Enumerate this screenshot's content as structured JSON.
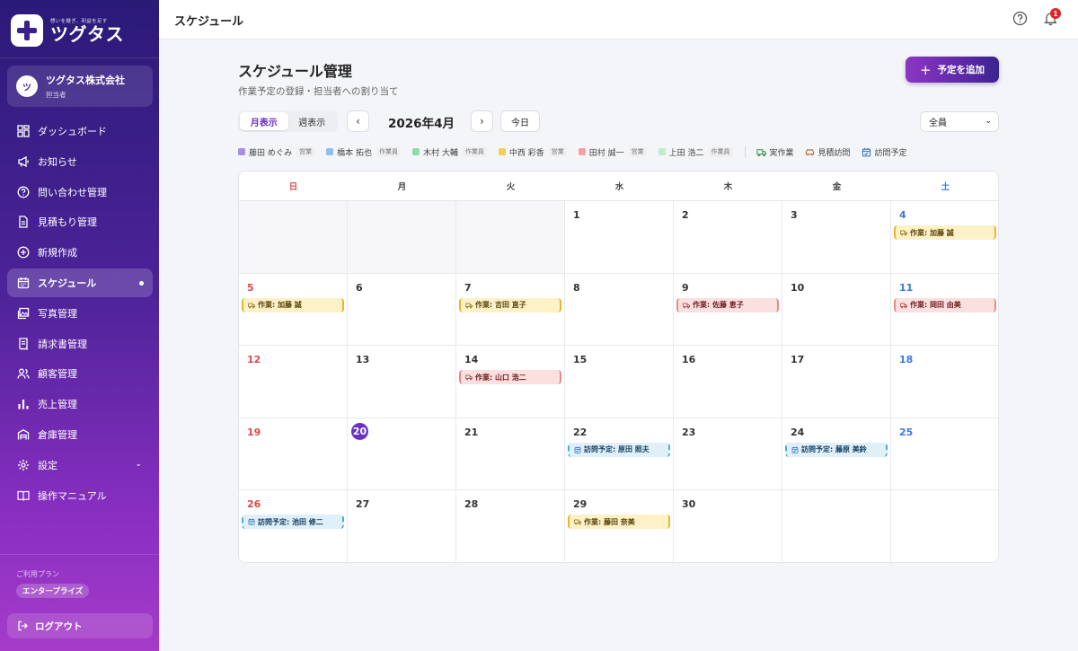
{
  "sidebar": {
    "logo_tagline": "想いを継ぎ、利益を足す",
    "logo_name": "ツグタス",
    "company_initial": "ツ",
    "company_name": "ツグタス株式会社",
    "company_role": "担当者",
    "items": [
      {
        "label": "ダッシュボード",
        "icon": "dashboard-icon"
      },
      {
        "label": "お知らせ",
        "icon": "megaphone-icon"
      },
      {
        "label": "問い合わせ管理",
        "icon": "question-icon"
      },
      {
        "label": "見積もり管理",
        "icon": "document-icon"
      },
      {
        "label": "新規作成",
        "icon": "plus-circle-icon"
      },
      {
        "label": "スケジュール",
        "icon": "calendar-icon"
      },
      {
        "label": "写真管理",
        "icon": "photo-icon"
      },
      {
        "label": "請求書管理",
        "icon": "invoice-icon"
      },
      {
        "label": "顧客管理",
        "icon": "users-icon"
      },
      {
        "label": "売上管理",
        "icon": "bar-chart-icon"
      },
      {
        "label": "倉庫管理",
        "icon": "warehouse-icon"
      },
      {
        "label": "設定",
        "icon": "gear-icon"
      },
      {
        "label": "操作マニュアル",
        "icon": "book-icon"
      }
    ],
    "active_index": 5,
    "plan_label": "ご利用プラン",
    "plan_name": "エンタープライズ",
    "logout_label": "ログアウト"
  },
  "topbar": {
    "title": "スケジュール",
    "notification_count": "1"
  },
  "header": {
    "title": "スケジュール管理",
    "subtitle": "作業予定の登録・担当者への割り当て",
    "add_button": "予定を追加"
  },
  "toolbar": {
    "view_month": "月表示",
    "view_week": "週表示",
    "active_view": "month",
    "prev": "‹",
    "next": "›",
    "month_label": "2026年4月",
    "today": "今日",
    "member_filter": "全員"
  },
  "legend": {
    "members": [
      {
        "name": "藤田 めぐみ",
        "role": "営業",
        "color": "#a98ce6"
      },
      {
        "name": "橋本 拓也",
        "role": "作業員",
        "color": "#8fbef0"
      },
      {
        "name": "木村 大輔",
        "role": "作業員",
        "color": "#8fdcab"
      },
      {
        "name": "中西 彩香",
        "role": "営業",
        "color": "#f5cf5a"
      },
      {
        "name": "田村 誠一",
        "role": "営業",
        "color": "#f0a3a3"
      },
      {
        "name": "上田 浩二",
        "role": "作業員",
        "color": "#bfeccf"
      }
    ],
    "types": [
      {
        "label": "実作業",
        "icon": "truck-icon",
        "color": "#2f8f4e"
      },
      {
        "label": "見積訪問",
        "icon": "car-icon",
        "color": "#b4651e"
      },
      {
        "label": "訪問予定",
        "icon": "calendar-check-icon",
        "color": "#2b6fb8"
      }
    ]
  },
  "calendar": {
    "weekdays": [
      "日",
      "月",
      "火",
      "水",
      "木",
      "金",
      "土"
    ],
    "today": 20,
    "weeks": [
      [
        null,
        null,
        null,
        {
          "day": 1
        },
        {
          "day": 2
        },
        {
          "day": 3
        },
        {
          "day": 4,
          "event": {
            "label": "作業: 加藤 誠",
            "kind": "work-yellow"
          }
        }
      ],
      [
        {
          "day": 5,
          "event": {
            "label": "作業: 加藤 誠",
            "kind": "work-yellow"
          }
        },
        {
          "day": 6
        },
        {
          "day": 7,
          "event": {
            "label": "作業: 吉田 直子",
            "kind": "work-yellow"
          }
        },
        {
          "day": 8
        },
        {
          "day": 9,
          "event": {
            "label": "作業: 佐藤 恵子",
            "kind": "work-red"
          }
        },
        {
          "day": 10
        },
        {
          "day": 11,
          "event": {
            "label": "作業: 岡田 由美",
            "kind": "work-red"
          }
        }
      ],
      [
        {
          "day": 12
        },
        {
          "day": 13
        },
        {
          "day": 14,
          "event": {
            "label": "作業: 山口 浩二",
            "kind": "work-red"
          }
        },
        {
          "day": 15
        },
        {
          "day": 16
        },
        {
          "day": 17
        },
        {
          "day": 18
        }
      ],
      [
        {
          "day": 19
        },
        {
          "day": 20
        },
        {
          "day": 21
        },
        {
          "day": 22,
          "event": {
            "label": "訪問予定: 原田 照夫",
            "kind": "visit"
          }
        },
        {
          "day": 23
        },
        {
          "day": 24,
          "event": {
            "label": "訪問予定: 藤原 美鈴",
            "kind": "visit"
          }
        },
        {
          "day": 25
        }
      ],
      [
        {
          "day": 26,
          "event": {
            "label": "訪問予定: 池田 修二",
            "kind": "visit"
          }
        },
        {
          "day": 27
        },
        {
          "day": 28
        },
        {
          "day": 29,
          "event": {
            "label": "作業: 藤田 奈美",
            "kind": "work-yellow"
          }
        },
        {
          "day": 30
        },
        null,
        null
      ]
    ]
  }
}
